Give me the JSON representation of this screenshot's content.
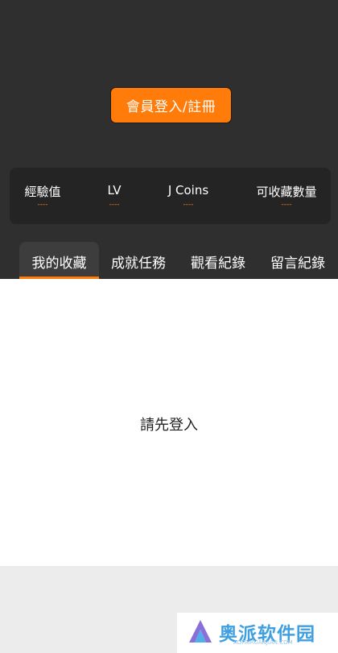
{
  "header": {
    "login_button": "會員登入/註冊"
  },
  "stats": [
    {
      "label": "經驗值",
      "value": "----"
    },
    {
      "label": "LV",
      "value": "----"
    },
    {
      "label": "J Coins",
      "value": "----"
    },
    {
      "label": "可收藏數量",
      "value": "----"
    }
  ],
  "tabs": [
    {
      "label": "我的收藏",
      "active": true
    },
    {
      "label": "成就任務",
      "active": false
    },
    {
      "label": "觀看紀錄",
      "active": false
    },
    {
      "label": "留言紀錄",
      "active": false
    }
  ],
  "content": {
    "empty_message": "請先登入"
  },
  "watermark": {
    "text": "奥派软件园",
    "url": "AOPAIRUANJIAN.COM"
  },
  "colors": {
    "accent": "#ff7b0a",
    "header_bg": "#2f2f2f",
    "stats_bg": "#242424"
  }
}
